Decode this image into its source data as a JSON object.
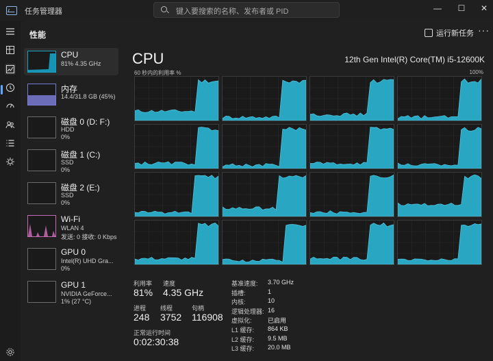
{
  "app": {
    "title": "任务管理器"
  },
  "search": {
    "placeholder": "键入要搜索的名称、发布者或 PID"
  },
  "window": {
    "minimize": "—",
    "maximize": "☐",
    "close": "✕"
  },
  "nav": [
    "hamburger-icon",
    "processes-icon",
    "performance-icon",
    "app-history-icon",
    "startup-icon",
    "users-icon",
    "details-icon",
    "services-icon",
    "settings-icon"
  ],
  "header": {
    "title": "性能",
    "run_task": "运行新任务",
    "more": "···"
  },
  "devices": [
    {
      "name": "CPU",
      "s1": "81% 4.35 GHz",
      "s2": "",
      "color": "#17a2c4"
    },
    {
      "name": "内存",
      "s1": "14.4/31.8 GB (45%)",
      "s2": "",
      "color": "#7a7dd6"
    },
    {
      "name": "磁盘 0 (D: F:)",
      "s1": "HDD",
      "s2": "0%",
      "color": "#6c6c6c"
    },
    {
      "name": "磁盘 1 (C:)",
      "s1": "SSD",
      "s2": "0%",
      "color": "#6c6c6c"
    },
    {
      "name": "磁盘 2 (E:)",
      "s1": "SSD",
      "s2": "0%",
      "color": "#6c6c6c"
    },
    {
      "name": "Wi-Fi",
      "s1": "WLAN 4",
      "s2": "发送: 0 接收: 0 Kbps",
      "color": "#c86bb5"
    },
    {
      "name": "GPU 0",
      "s1": "Intel(R) UHD Gra...",
      "s2": "0%",
      "color": "#6c6c6c"
    },
    {
      "name": "GPU 1",
      "s1": "NVIDIA GeForce...",
      "s2": "1% (27 °C)",
      "color": "#6c6c6c"
    }
  ],
  "cpu": {
    "title": "CPU",
    "model": "12th Gen Intel(R) Core(TM) i5-12600K",
    "axis_left": "60 秒内的利用率 %",
    "axis_right": "100%",
    "graph_color": "#29a6c1",
    "stats": {
      "util_label": "利用率",
      "util": "81%",
      "speed_label": "速度",
      "speed": "4.35 GHz",
      "proc_label": "进程",
      "proc": "248",
      "thread_label": "线程",
      "thread": "3752",
      "handle_label": "句柄",
      "handle": "116908",
      "uptime_label": "正常运行时间",
      "uptime": "0:02:30:38"
    },
    "specs": [
      {
        "label": "基准速度:",
        "value": "3.70 GHz"
      },
      {
        "label": "插槽:",
        "value": "1"
      },
      {
        "label": "内核:",
        "value": "10"
      },
      {
        "label": "逻辑处理器:",
        "value": "16"
      },
      {
        "label": "虚拟化:",
        "value": "已启用"
      },
      {
        "label": "L1 缓存:",
        "value": "864 KB"
      },
      {
        "label": "L2 缓存:",
        "value": "9.5 MB"
      },
      {
        "label": "L3 缓存:",
        "value": "20.0 MB"
      }
    ]
  }
}
